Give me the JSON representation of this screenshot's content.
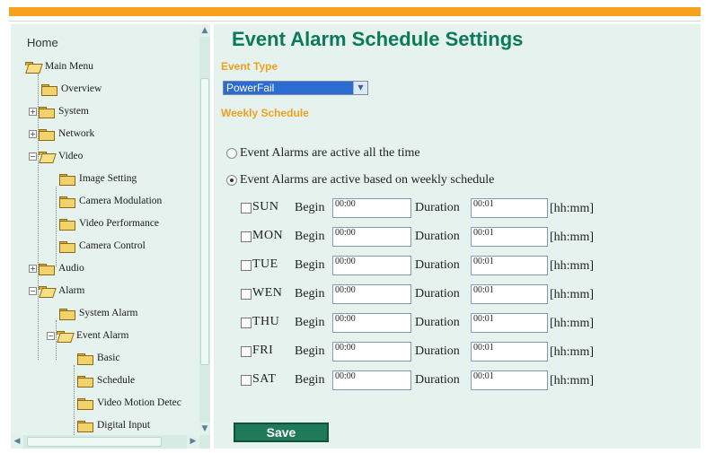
{
  "tree": {
    "home": "Home",
    "items": [
      {
        "label": "Main Menu"
      },
      {
        "label": "Overview"
      },
      {
        "label": "System"
      },
      {
        "label": "Network"
      },
      {
        "label": "Video"
      },
      {
        "label": "Image Setting"
      },
      {
        "label": "Camera Modulation"
      },
      {
        "label": "Video Performance"
      },
      {
        "label": "Camera Control"
      },
      {
        "label": "Audio"
      },
      {
        "label": "Alarm"
      },
      {
        "label": "System Alarm"
      },
      {
        "label": "Event Alarm"
      },
      {
        "label": "Basic"
      },
      {
        "label": "Schedule"
      },
      {
        "label": "Video Motion Detec"
      },
      {
        "label": "Digital Input"
      }
    ]
  },
  "main": {
    "title": "Event Alarm Schedule Settings",
    "event_type_label": "Event Type",
    "event_type_value": "PowerFail",
    "weekly_schedule_label": "Weekly Schedule",
    "radio_all_time": "Event Alarms are active all the time",
    "radio_weekly": "Event Alarms are active based on weekly schedule",
    "radio_selected": "weekly",
    "begin_label": "Begin",
    "duration_label": "Duration",
    "unit_label": "[hh:mm]",
    "days": [
      {
        "day": "SUN",
        "begin": "00:00",
        "duration": "00:01",
        "checked": false
      },
      {
        "day": "MON",
        "begin": "00:00",
        "duration": "00:01",
        "checked": false
      },
      {
        "day": "TUE",
        "begin": "00:00",
        "duration": "00:01",
        "checked": false
      },
      {
        "day": "WEN",
        "begin": "00:00",
        "duration": "00:01",
        "checked": false
      },
      {
        "day": "THU",
        "begin": "00:00",
        "duration": "00:01",
        "checked": false
      },
      {
        "day": "FRI",
        "begin": "00:00",
        "duration": "00:01",
        "checked": false
      },
      {
        "day": "SAT",
        "begin": "00:00",
        "duration": "00:01",
        "checked": false
      }
    ],
    "save_label": "Save"
  },
  "colors": {
    "accent_orange": "#f7a11e",
    "title_green": "#0a7a5a",
    "panel_bg": "#e6f2ee",
    "button_green": "#1f7a5a",
    "select_blue": "#2c6bd2"
  }
}
